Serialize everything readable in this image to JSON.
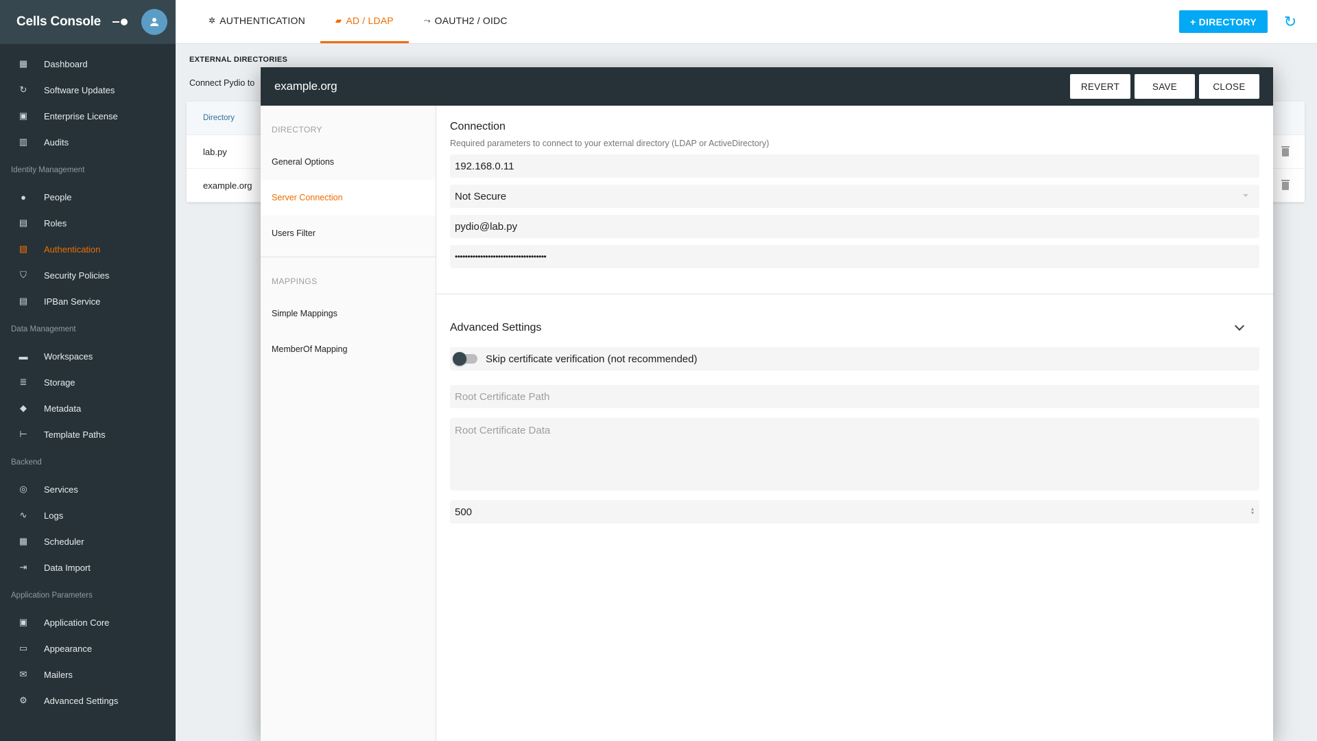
{
  "sidebar": {
    "title": "Cells Console",
    "top_items": [
      {
        "label": "Dashboard",
        "icon": "dashboard-icon"
      },
      {
        "label": "Software Updates",
        "icon": "update-icon"
      },
      {
        "label": "Enterprise License",
        "icon": "license-icon"
      },
      {
        "label": "Audits",
        "icon": "audits-icon"
      }
    ],
    "sections": [
      {
        "title": "Identity Management",
        "items": [
          {
            "label": "People",
            "icon": "people-icon"
          },
          {
            "label": "Roles",
            "icon": "roles-icon"
          },
          {
            "label": "Authentication",
            "icon": "authentication-icon",
            "active": true
          },
          {
            "label": "Security Policies",
            "icon": "shield-icon"
          },
          {
            "label": "IPBan Service",
            "icon": "ipban-icon"
          }
        ]
      },
      {
        "title": "Data Management",
        "items": [
          {
            "label": "Workspaces",
            "icon": "folder-icon"
          },
          {
            "label": "Storage",
            "icon": "storage-icon"
          },
          {
            "label": "Metadata",
            "icon": "tags-icon"
          },
          {
            "label": "Template Paths",
            "icon": "tree-icon"
          }
        ]
      },
      {
        "title": "Backend",
        "items": [
          {
            "label": "Services",
            "icon": "services-icon"
          },
          {
            "label": "Logs",
            "icon": "pulse-icon"
          },
          {
            "label": "Scheduler",
            "icon": "scheduler-icon"
          },
          {
            "label": "Data Import",
            "icon": "import-icon"
          }
        ]
      },
      {
        "title": "Application Parameters",
        "items": [
          {
            "label": "Application Core",
            "icon": "core-icon"
          },
          {
            "label": "Appearance",
            "icon": "monitor-icon"
          },
          {
            "label": "Mailers",
            "icon": "mail-icon"
          },
          {
            "label": "Advanced Settings",
            "icon": "gear-icon"
          }
        ]
      }
    ]
  },
  "topbar": {
    "tabs": [
      {
        "label": "AUTHENTICATION",
        "icon": "gear-icon"
      },
      {
        "label": "AD / LDAP",
        "icon": "folder-icon",
        "active": true
      },
      {
        "label": "OAUTH2 / OIDC",
        "icon": "oauth-icon"
      }
    ],
    "add_directory_label": "+ DIRECTORY"
  },
  "background": {
    "section_title": "EXTERNAL DIRECTORIES",
    "description": "Connect Pydio to",
    "table_header": "Directory",
    "rows": [
      "lab.py",
      "example.org"
    ]
  },
  "modal": {
    "title": "example.org",
    "buttons": {
      "revert": "REVERT",
      "save": "SAVE",
      "close": "CLOSE"
    },
    "menu": {
      "section_directory": "DIRECTORY",
      "items_directory": [
        "General Options",
        "Server Connection",
        "Users Filter"
      ],
      "active_item": "Server Connection",
      "section_mappings": "MAPPINGS",
      "items_mappings": [
        "Simple Mappings",
        "MemberOf Mapping"
      ]
    },
    "connection": {
      "title": "Connection",
      "subtitle": "Required parameters to connect to your external directory (LDAP or ActiveDirectory)",
      "host": "192.168.0.11",
      "security": "Not Secure",
      "bind_dn": "pydio@lab.py",
      "password": "••••••••••••••••••••••••••••••••••••"
    },
    "advanced": {
      "title": "Advanced Settings",
      "skip_verify_label": "Skip certificate verification (not recommended)",
      "skip_verify": false,
      "root_cert_path_placeholder": "Root Certificate Path",
      "root_cert_data_placeholder": "Root Certificate Data",
      "page_size": "500"
    }
  },
  "colors": {
    "sidebar_bg": "#263238",
    "accent": "#ef6c00",
    "primary_button": "#03a9f4"
  }
}
